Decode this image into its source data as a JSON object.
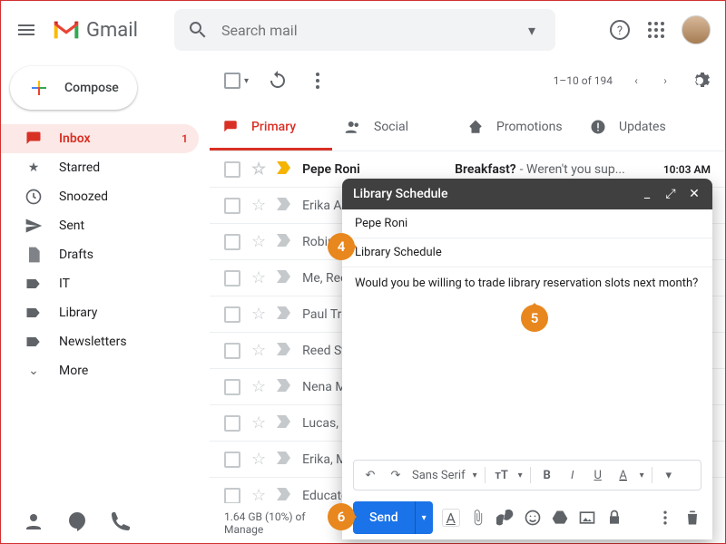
{
  "app": {
    "name": "Gmail"
  },
  "search": {
    "placeholder": "Search mail"
  },
  "compose_button": "Compose",
  "sidebar": {
    "items": [
      {
        "label": "Inbox",
        "badge": "1"
      },
      {
        "label": "Starred"
      },
      {
        "label": "Snoozed"
      },
      {
        "label": "Sent"
      },
      {
        "label": "Drafts"
      },
      {
        "label": "IT"
      },
      {
        "label": "Library"
      },
      {
        "label": "Newsletters"
      },
      {
        "label": "More"
      }
    ]
  },
  "toolbar": {
    "page_count": "1–10 of 194"
  },
  "tabs": [
    {
      "label": "Primary"
    },
    {
      "label": "Social"
    },
    {
      "label": "Promotions"
    },
    {
      "label": "Updates"
    }
  ],
  "emails": [
    {
      "sender": "Pepe Roni",
      "subject": "Breakfast?",
      "preview": " - Weren't you sup...",
      "time": "10:03 AM",
      "unread": true
    },
    {
      "sender": "Erika Araujo",
      "time": ""
    },
    {
      "sender": "Robin Banks",
      "time": ""
    },
    {
      "sender": "Me, Reed",
      "time": ""
    },
    {
      "sender": "Paul Tronckowiak",
      "time": ""
    },
    {
      "sender": "Reed Stevens",
      "time": ""
    },
    {
      "sender": "Nena Moran",
      "time": ""
    },
    {
      "sender": "Lucas, Erika",
      "time": ""
    },
    {
      "sender": "Erika, Me",
      "time": ""
    },
    {
      "sender": "Educator",
      "time": ""
    }
  ],
  "footer": {
    "storage": "1.64 GB (10%) of",
    "manage": "Manage"
  },
  "compose": {
    "title": "Library Schedule",
    "to": "Pepe Roni",
    "subject": "Library Schedule",
    "body": "Would you be willing to trade library reservation slots next month?",
    "send": "Send",
    "font": "Sans Serif"
  },
  "callouts": {
    "c4": "4",
    "c5": "5",
    "c6": "6"
  }
}
